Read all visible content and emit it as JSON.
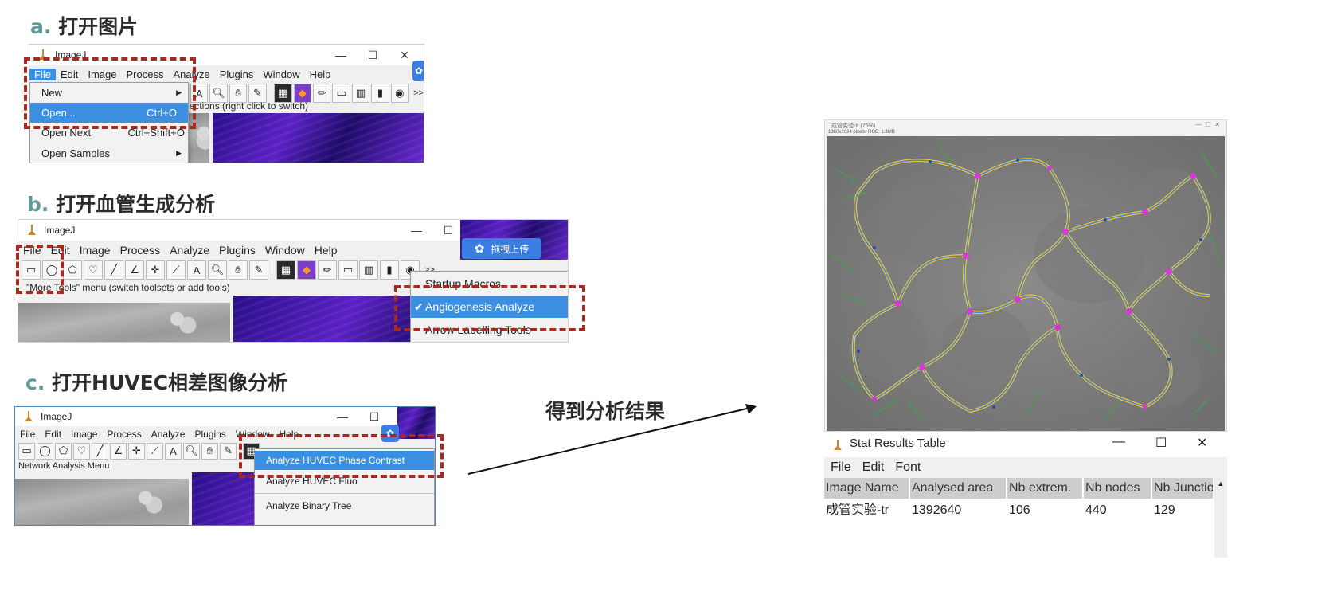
{
  "steps": {
    "a": {
      "letter": "a.",
      "title": "打开图片"
    },
    "b": {
      "letter": "b.",
      "title": "打开血管生成分析"
    },
    "c": {
      "letter": "c.",
      "title": "打开HUVEC相差图像分析"
    },
    "result_label": "得到分析结果"
  },
  "window_a": {
    "title": "ImageJ",
    "menu": [
      "File",
      "Edit",
      "Image",
      "Process",
      "Analyze",
      "Plugins",
      "Window",
      "Help"
    ],
    "status": "lections (right click to switch)",
    "more_label": ">>",
    "file_menu": [
      {
        "label": "New",
        "shortcut": "",
        "submenu": true
      },
      {
        "label": "Open...",
        "shortcut": "Ctrl+O",
        "submenu": false
      },
      {
        "label": "Open Next",
        "shortcut": "Ctrl+Shift+O",
        "submenu": false
      },
      {
        "label": "Open Samples",
        "shortcut": "",
        "submenu": true
      }
    ]
  },
  "window_b": {
    "title": "ImageJ",
    "menu": [
      "File",
      "Edit",
      "Image",
      "Process",
      "Analyze",
      "Plugins",
      "Window",
      "Help"
    ],
    "status": "\"More Tools\" menu (switch toolsets or add tools)",
    "upload_label": "拖拽上传",
    "more_label": ">>",
    "tools_menu": [
      {
        "label": "Startup Macros",
        "checked": false
      },
      {
        "label": "Angiogenesis Analyze",
        "checked": true
      },
      {
        "label": "Arrow Labelling Tools",
        "checked": false
      }
    ],
    "check_mark": "✔"
  },
  "window_c": {
    "title": "ImageJ",
    "menu": [
      "File",
      "Edit",
      "Image",
      "Process",
      "Analyze",
      "Plugins",
      "Window",
      "Help"
    ],
    "status": "Network Analysis Menu",
    "menu_items": [
      "Analyze HUVEC Phase Contrast",
      "Analyze HUVEC Fluo",
      "Analyze Binary Tree"
    ]
  },
  "result_image": {
    "title": "成管实验-tr (75%)",
    "info": "1360x1024 pixels; RGB; 1.3MB"
  },
  "stat_table": {
    "title": "Stat Results Table",
    "menu": [
      "File",
      "Edit",
      "Font"
    ],
    "columns": [
      "Image Name",
      "Analysed area",
      "Nb extrem.",
      "Nb nodes",
      "Nb Junctio"
    ],
    "rows": [
      [
        "成管实验-tr",
        "1392640",
        "106",
        "440",
        "129"
      ]
    ]
  },
  "colors": {
    "dashed_box": "#a52a22",
    "menu_highlight": "#3c8fe0",
    "step_letter": "#5e9a9a",
    "segment_yellow": "#f2c230",
    "segment_blue": "#3f86d8",
    "node_magenta": "#d63ad6",
    "branch_green": "#3fa34a"
  },
  "icons": {
    "window_minimize": "minimize-icon",
    "window_maximize": "maximize-icon",
    "window_close": "close-icon"
  }
}
